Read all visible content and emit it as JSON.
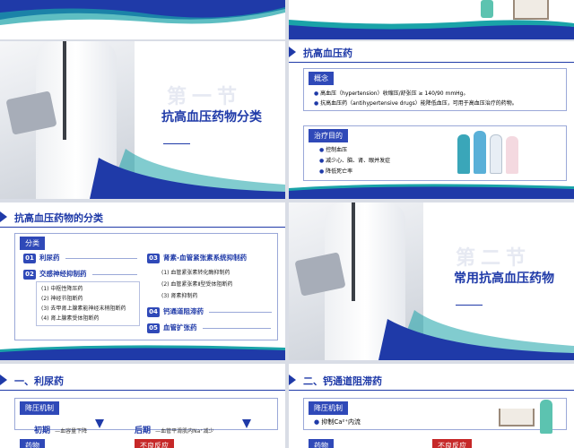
{
  "slides": {
    "s1": {
      "lines_icon": "menu-lines-icon"
    },
    "s2": {},
    "s3": {
      "watermark": "第一节",
      "title": "抗高血压药物分类"
    },
    "s4": {
      "title": "抗高血压药",
      "concept_label": "概念",
      "concept_items": [
        "高血压（hypertension）收缩压/舒张压 ≥ 140/90 mmHg。",
        "抗高血压药（antihypertensive drugs）能降低血压，可用于高血压治疗的药物。"
      ],
      "goal_label": "治疗目的",
      "goal_items": [
        "控制血压",
        "减少心、脑、肾、眼并发症",
        "降低死亡率"
      ]
    },
    "s5": {
      "title": "抗高血压药物的分类",
      "section_label": "分类",
      "left": [
        {
          "num": "01",
          "name": "利尿药",
          "subs": []
        },
        {
          "num": "02",
          "name": "交感神经抑制药",
          "subs": [
            "(1) 中枢性降压药",
            "(2) 神经节阻断药",
            "(3) 去甲肾上腺素能神经末梢阻断药",
            "(4) 肾上腺素受体阻断药"
          ]
        }
      ],
      "right": [
        {
          "num": "03",
          "name": "肾素-血管紧张素系统抑制药",
          "subs": [
            "(1) 血管紧张素转化酶抑制药",
            "(2) 血管紧张素Ⅱ型受体阻断药",
            "(3) 肾素抑制药"
          ]
        },
        {
          "num": "04",
          "name": "钙通道阻滞药",
          "subs": []
        },
        {
          "num": "05",
          "name": "血管扩张药",
          "subs": []
        }
      ]
    },
    "s6": {
      "watermark": "第二节",
      "title": "常用抗高血压药物"
    },
    "s7": {
      "title": "一、利尿药",
      "mech_label": "降压机制",
      "early_label": "初期",
      "early_text": "—血容量下降",
      "late_label": "后期",
      "late_text": "—血管平滑肌内Na⁺减少",
      "drug_label": "药物",
      "adverse_label": "不良反应"
    },
    "s8": {
      "title": "二、钙通道阻滞药",
      "mech_label": "降压机制",
      "mech_item": "抑制Ca²⁺内流",
      "drug_label": "药物",
      "adverse_label": "不良反应"
    }
  },
  "colors": {
    "brand": "#1f3aa8",
    "accent": "#c62828",
    "teal": "#1aa3a8"
  }
}
